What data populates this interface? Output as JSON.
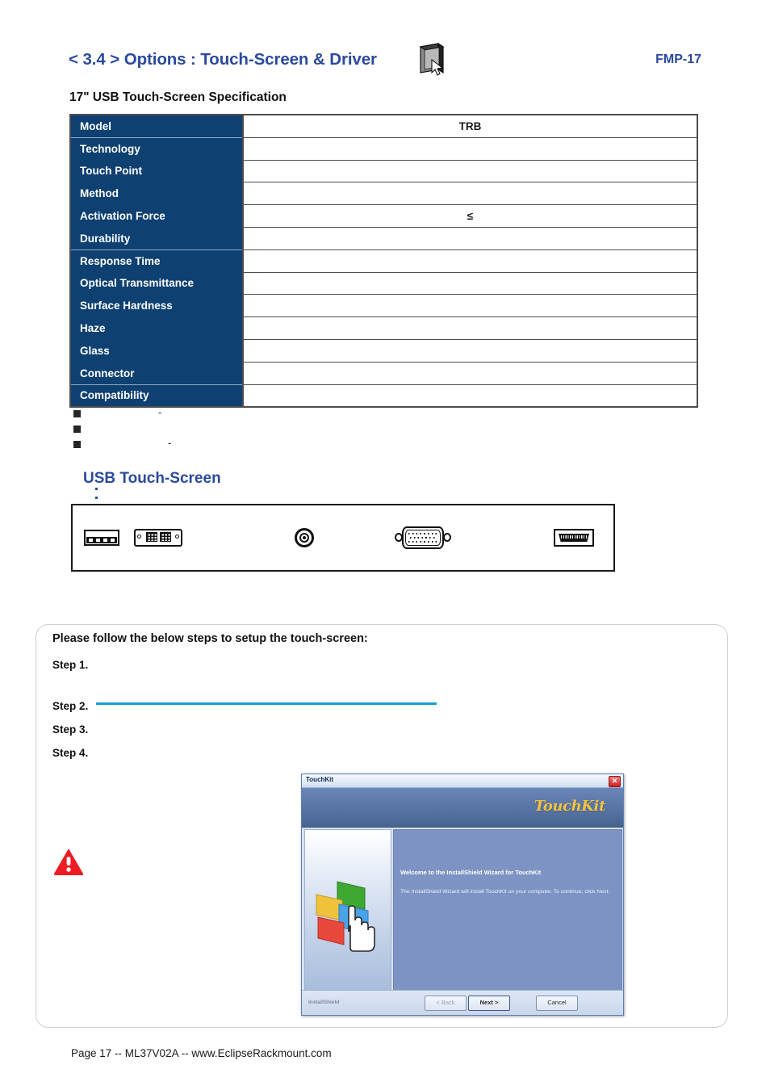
{
  "header": {
    "title": "< 3.4 > Options : Touch-Screen & Driver",
    "page_code": "FMP-17",
    "icon": "monitor-cursor-icon",
    "accent_color": "#2b4a9b"
  },
  "spec": {
    "title": "17\" USB Touch-Screen Specification",
    "columns": [
      "Model",
      "TRB"
    ],
    "header_bg": "#0e4071",
    "rows": [
      {
        "label": "Model",
        "value": "TRB",
        "is_header": true
      },
      {
        "label": "Technology",
        "value": ""
      },
      {
        "label": "Touch Point",
        "value": ""
      },
      {
        "label": "Method",
        "value": ""
      },
      {
        "label": "Activation Force",
        "value": "≤"
      },
      {
        "label": "Durability",
        "value": ""
      },
      {
        "label": "Response Time",
        "value": ""
      },
      {
        "label": "Optical Transmittance",
        "value": ""
      },
      {
        "label": "Surface Hardness",
        "value": ""
      },
      {
        "label": "Haze",
        "value": ""
      },
      {
        "label": "Glass",
        "value": ""
      },
      {
        "label": "Connector",
        "value": ""
      },
      {
        "label": "Compatibility",
        "value": ""
      }
    ]
  },
  "notes": [
    {
      "bullet": "square-bullet",
      "text": "-"
    },
    {
      "bullet": "square-bullet",
      "text": ""
    },
    {
      "bullet": "square-bullet",
      "text": "-"
    }
  ],
  "connector_panel": {
    "heading": "USB Touch-Screen",
    "connectors": [
      {
        "name": "terminal-block-connector"
      },
      {
        "name": "dvi-connector"
      },
      {
        "name": "bnc-connector"
      },
      {
        "name": "vga-connector"
      },
      {
        "name": "hdmi-connector"
      }
    ]
  },
  "steps_card": {
    "intro": "Please follow the below steps to setup the touch-screen:",
    "steps": [
      {
        "label": "Step 1.",
        "text": ""
      },
      {
        "label": "Step 2.",
        "text": ""
      },
      {
        "label": "Step 3.",
        "text": ""
      },
      {
        "label": "Step 4.",
        "text": ""
      }
    ],
    "link_color": "#139fd7",
    "warning_icon": "warning-triangle-icon"
  },
  "touchkit_dialog": {
    "window_title": "TouchKit",
    "close_label": "✕",
    "brand": "TouchKit",
    "welcome": "Welcome to the InstallShield Wizard for TouchKit",
    "description": "The InstallShield Wizard will install TouchKit on your computer.  To continue, click Next.",
    "installshield_label": "InstallShield",
    "buttons": {
      "back": "< Back",
      "next": "Next >",
      "cancel": "Cancel"
    }
  },
  "footer": {
    "text": "Page 17 -- ML37V02A -- www.EclipseRackmount.com"
  }
}
